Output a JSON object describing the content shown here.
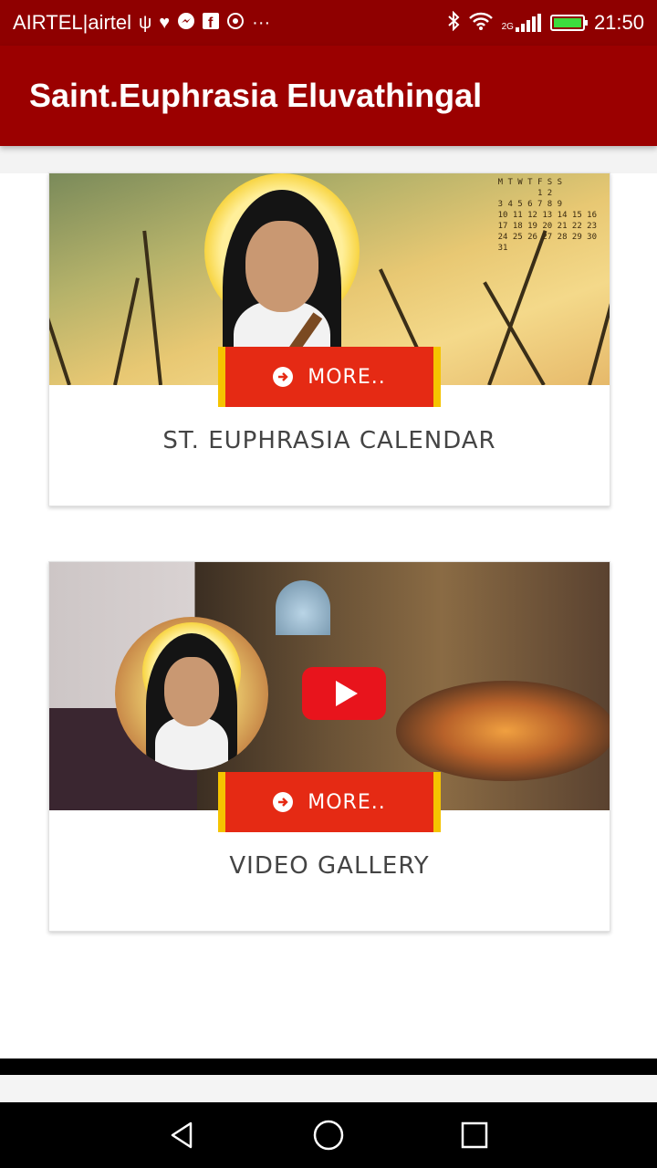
{
  "status_bar": {
    "carrier": "AIRTEL|airtel",
    "network_label": "2G",
    "time": "21:50",
    "icons": [
      "usb-icon",
      "heart-icon",
      "messenger-icon",
      "facebook-icon",
      "whatsapp-icon",
      "more-notifications-icon",
      "bluetooth-icon",
      "wifi-icon",
      "signal-icon",
      "battery-charging-icon"
    ]
  },
  "app_bar": {
    "title": "Saint.Euphrasia Eluvathingal"
  },
  "cards": [
    {
      "image": "saint-euphrasia-calendar-banner",
      "button_label": "MORE..",
      "caption": "ST. EUPHRASIA CALENDAR",
      "calendar_header": "M T W T F S S",
      "calendar_rows": [
        "        1 2",
        "3 4 5 6 7 8 9",
        "10 11 12 13 14 15 16",
        "17 18 19 20 21 22 23",
        "24 25 26 27 28 29 30",
        "31"
      ]
    },
    {
      "image": "video-gallery-banner",
      "button_label": "MORE..",
      "caption": "VIDEO GALLERY"
    }
  ],
  "nav_bar": {
    "icons": [
      "back-icon",
      "home-icon",
      "recents-icon"
    ]
  },
  "colors": {
    "status_bar": "#8f0000",
    "app_bar": "#9b0000",
    "button_red": "#e52a14",
    "button_yellow": "#f5c400"
  }
}
